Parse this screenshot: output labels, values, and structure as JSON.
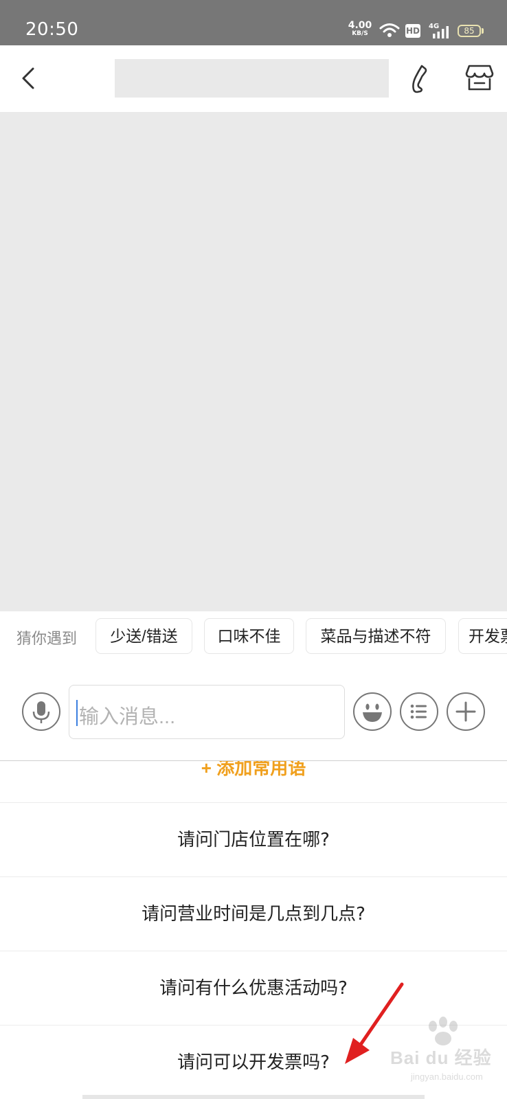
{
  "status_bar": {
    "time": "20:50",
    "net_speed_value": "4.00",
    "net_speed_unit": "KB/S",
    "hd_label": "HD",
    "network_label": "4G",
    "battery_level": "85"
  },
  "header": {
    "back_icon": "chevron-left-icon",
    "phone_icon": "phone-icon",
    "shop_icon": "store-icon"
  },
  "suggestions": {
    "label": "猜你遇到",
    "chips": [
      "少送/错送",
      "口味不佳",
      "菜品与描述不符",
      "开发票"
    ]
  },
  "composer": {
    "placeholder": "输入消息...",
    "icons": [
      "microphone-icon",
      "emoji-icon",
      "list-icon",
      "plus-icon"
    ]
  },
  "phrases": {
    "add_label": "+ 添加常用语",
    "items": [
      "请问门店位置在哪?",
      "请问营业时间是几点到几点?",
      "请问有什么优惠活动吗?",
      "请问可以开发票吗?"
    ]
  },
  "watermark": {
    "text": "Bai du 经验",
    "sub": "jingyan.baidu.com"
  },
  "colors": {
    "status_bar_bg": "#777777",
    "chat_bg": "#eaeaea",
    "accent_orange": "#f0a01e",
    "annotation_red": "#e02020",
    "caret_blue": "#3b7fe0"
  }
}
